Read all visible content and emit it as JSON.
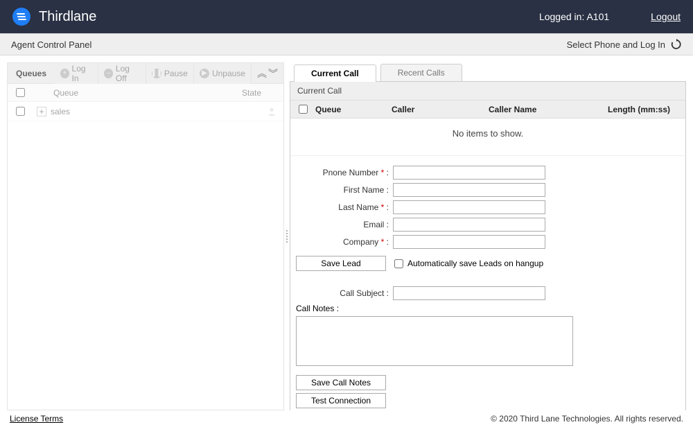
{
  "header": {
    "brand": "Thirdlane",
    "logged_in_label": "Logged in:",
    "logged_in_user": "A101",
    "logout": "Logout"
  },
  "subbar": {
    "title": "Agent Control Panel",
    "select_phone": "Select Phone and Log In"
  },
  "queues_panel": {
    "title": "Queues",
    "buttons": {
      "login": "Log In",
      "logoff": "Log Off",
      "pause": "Pause",
      "unpause": "Unpause"
    },
    "columns": {
      "queue": "Queue",
      "state": "State"
    },
    "rows": [
      {
        "name": "sales"
      }
    ]
  },
  "tabs": {
    "current": "Current Call",
    "recent": "Recent Calls"
  },
  "current_call": {
    "section_title": "Current Call",
    "columns": {
      "queue": "Queue",
      "caller": "Caller",
      "caller_name": "Caller Name",
      "length": "Length (mm:ss)"
    },
    "empty": "No items to show.",
    "form": {
      "phone_label": "Pnone Number",
      "firstname_label": "First Name :",
      "lastname_label": "Last Name",
      "email_label": "Email :",
      "company_label": "Company",
      "save_lead": "Save Lead",
      "auto_save": "Automatically save Leads on hangup",
      "subject_label": "Call Subject :",
      "notes_label": "Call Notes :",
      "save_notes": "Save Call Notes",
      "test_conn": "Test Connection"
    }
  },
  "footer": {
    "license": "License Terms",
    "copyright": "© 2020 Third Lane Technologies. All rights reserved."
  }
}
